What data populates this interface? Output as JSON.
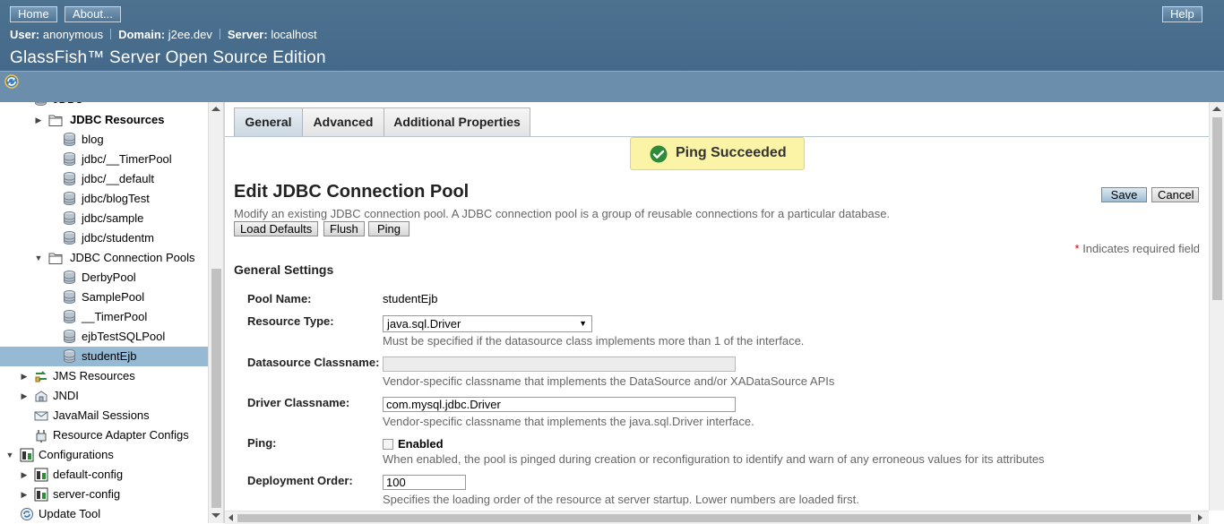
{
  "masthead": {
    "home_label": "Home",
    "about_label": "About...",
    "help_label": "Help",
    "user_label": "User:",
    "user_value": "anonymous",
    "domain_label": "Domain:",
    "domain_value": "j2ee.dev",
    "server_label": "Server:",
    "server_value": "localhost",
    "product_title": "GlassFish™ Server Open Source Edition"
  },
  "tree": {
    "partial_top_label": "JDBC",
    "items": [
      {
        "label": "JDBC Resources",
        "icon": "folder-icon",
        "twisty": "▶",
        "bold": true
      },
      {
        "label": "blog",
        "icon": "database-icon"
      },
      {
        "label": "jdbc/__TimerPool",
        "icon": "database-icon"
      },
      {
        "label": "jdbc/__default",
        "icon": "database-icon"
      },
      {
        "label": "jdbc/blogTest",
        "icon": "database-icon"
      },
      {
        "label": "jdbc/sample",
        "icon": "database-icon"
      },
      {
        "label": "jdbc/studentm",
        "icon": "database-icon"
      },
      {
        "label": "JDBC Connection Pools",
        "icon": "folder-icon",
        "twisty": "▼"
      },
      {
        "label": "DerbyPool",
        "icon": "database-icon"
      },
      {
        "label": "SamplePool",
        "icon": "database-icon"
      },
      {
        "label": "__TimerPool",
        "icon": "database-icon"
      },
      {
        "label": "ejbTestSQLPool",
        "icon": "database-icon"
      },
      {
        "label": "studentEjb",
        "icon": "database-icon",
        "selected": true
      },
      {
        "label": "JMS Resources",
        "icon": "jms-icon",
        "twisty": "▶"
      },
      {
        "label": "JNDI",
        "icon": "jndi-icon",
        "twisty": "▶"
      },
      {
        "label": "JavaMail Sessions",
        "icon": "mail-icon"
      },
      {
        "label": "Resource Adapter Configs",
        "icon": "adapter-icon"
      },
      {
        "label": "Configurations",
        "icon": "config-icon",
        "twisty": "▼"
      },
      {
        "label": "default-config",
        "icon": "config-icon",
        "twisty": "▶"
      },
      {
        "label": "server-config",
        "icon": "config-icon",
        "twisty": "▶"
      },
      {
        "label": "Update Tool",
        "icon": "update-tool-icon"
      }
    ]
  },
  "tabs": [
    "General",
    "Advanced",
    "Additional Properties"
  ],
  "ping_message": "Ping Succeeded",
  "page": {
    "title": "Edit JDBC Connection Pool",
    "help": "Modify an existing JDBC connection pool. A JDBC connection pool is a group of reusable connections for a particular database.",
    "buttons": {
      "load_defaults": "Load Defaults",
      "flush": "Flush",
      "ping": "Ping",
      "save": "Save",
      "cancel": "Cancel"
    },
    "required_star": "*",
    "required_note": "Indicates required field",
    "section_title": "General Settings"
  },
  "form": {
    "pool_name_label": "Pool Name:",
    "pool_name_value": "studentEjb",
    "resource_type_label": "Resource Type:",
    "resource_type_value": "java.sql.Driver",
    "resource_type_help": "Must be specified if the datasource class implements more than 1 of the interface.",
    "datasource_label": "Datasource Classname:",
    "datasource_value": "",
    "datasource_help": "Vendor-specific classname that implements the DataSource and/or XADataSource APIs",
    "driver_label": "Driver Classname:",
    "driver_value": "com.mysql.jdbc.Driver",
    "driver_help": "Vendor-specific classname that implements the java.sql.Driver interface.",
    "ping_label": "Ping:",
    "ping_enabled_label": "Enabled",
    "ping_help": "When enabled, the pool is pinged during creation or reconfiguration to identify and warn of any erroneous values for its attributes",
    "deploy_order_label": "Deployment Order:",
    "deploy_order_value": "100",
    "deploy_order_help": "Specifies the loading order of the resource at server startup. Lower numbers are loaded first."
  }
}
